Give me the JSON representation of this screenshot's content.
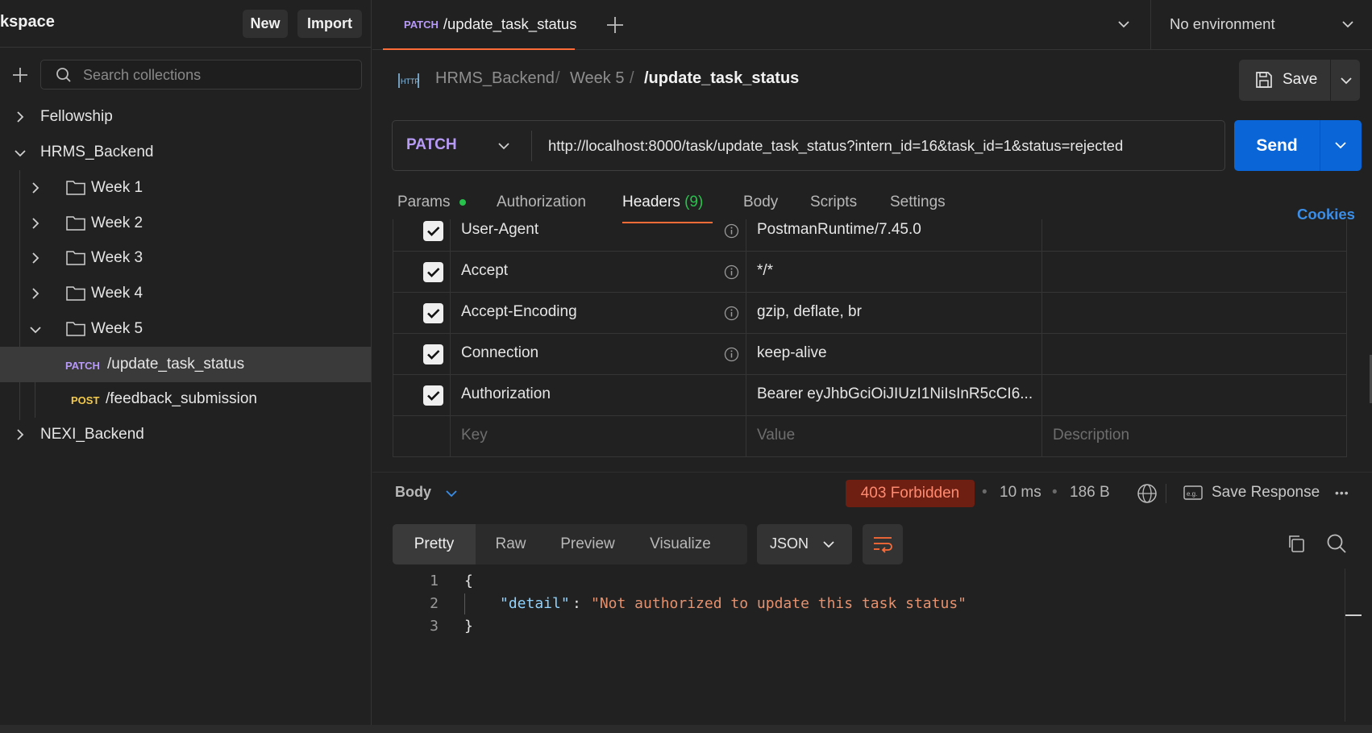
{
  "sidebar": {
    "workspace_title": "kspace",
    "new_label": "New",
    "import_label": "Import",
    "search_placeholder": "Search collections",
    "tree": {
      "fellowship": "Fellowship",
      "hrms": "HRMS_Backend",
      "week1": "Week 1",
      "week2": "Week 2",
      "week3": "Week 3",
      "week4": "Week 4",
      "week5": "Week 5",
      "req1_method": "PATCH",
      "req1_name": "/update_task_status",
      "req2_method": "POST",
      "req2_name": "/feedback_submission",
      "nexi": "NEXI_Backend"
    }
  },
  "tabs": {
    "active_method": "PATCH",
    "active_name": "/update_task_status",
    "environment": "No environment"
  },
  "breadcrumb": {
    "icon_text": "HTTP",
    "collection": "HRMS_Backend",
    "sep1": "/",
    "folder": "Week 5",
    "sep2": "/",
    "current": "/update_task_status"
  },
  "save_label": "Save",
  "request": {
    "method": "PATCH",
    "url": "http://localhost:8000/task/update_task_status?intern_id=16&task_id=1&status=rejected",
    "send_label": "Send"
  },
  "request_tabs": {
    "params": "Params",
    "authorization": "Authorization",
    "headers": "Headers",
    "headers_count": "(9)",
    "body": "Body",
    "scripts": "Scripts",
    "settings": "Settings",
    "cookies": "Cookies"
  },
  "headers": [
    {
      "key": "User-Agent",
      "value": "PostmanRuntime/7.45.0"
    },
    {
      "key": "Accept",
      "value": "*/*"
    },
    {
      "key": "Accept-Encoding",
      "value": "gzip, deflate, br"
    },
    {
      "key": "Connection",
      "value": "keep-alive"
    },
    {
      "key": "Authorization",
      "value": "Bearer eyJhbGciOiJIUzI1NiIsInR5cCI6..."
    }
  ],
  "headers_placeholder": {
    "key": "Key",
    "value": "Value",
    "description": "Description"
  },
  "response": {
    "section_label": "Body",
    "status": "403 Forbidden",
    "time": "10 ms",
    "size": "186 B",
    "save_response": "Save Response",
    "more": "•••",
    "dot": "•",
    "views": {
      "pretty": "Pretty",
      "raw": "Raw",
      "preview": "Preview",
      "visualize": "Visualize"
    },
    "format": "JSON",
    "lines": {
      "n1": "1",
      "n2": "2",
      "n3": "3",
      "open_brace": "{",
      "key": "\"detail\"",
      "colon": ":",
      "value": "\"Not authorized to update this task status\"",
      "close_brace": "}"
    }
  },
  "colors": {
    "accent_orange": "#ff6c37",
    "send_blue": "#0a66d6",
    "patch_purple": "#b79af5",
    "post_yellow": "#f2c94c",
    "json_key": "#8fd3fe",
    "json_string": "#e5916e",
    "green_dot": "#27c24c"
  }
}
